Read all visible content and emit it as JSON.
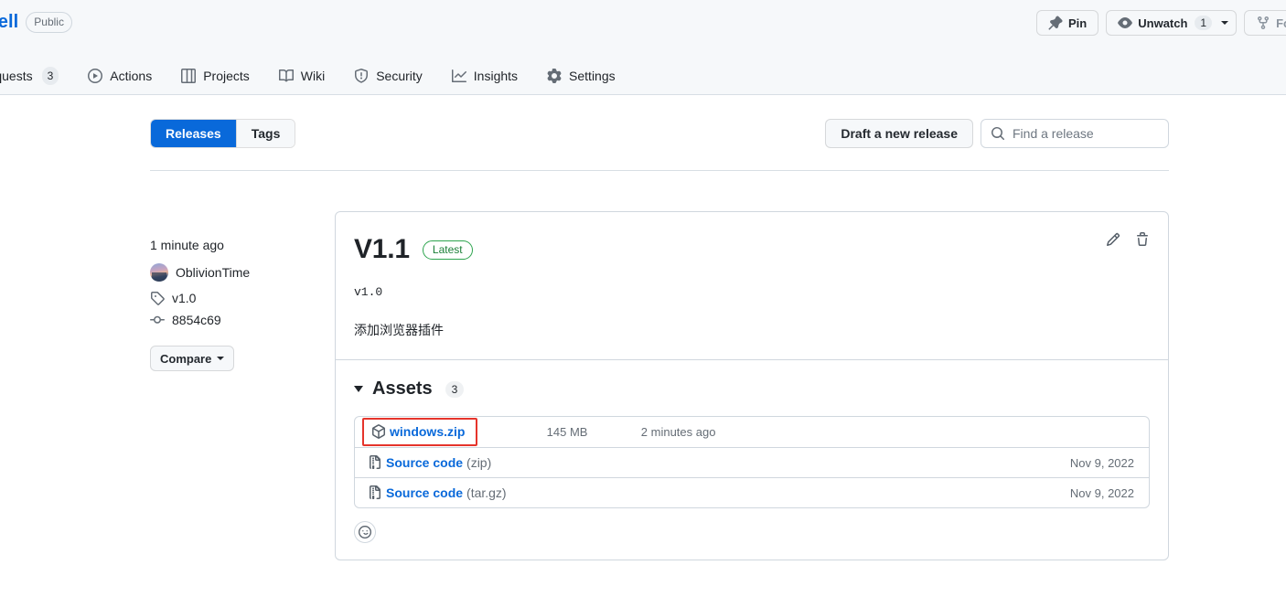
{
  "repo": {
    "name": "teShell",
    "visibility": "Public",
    "nav": [
      {
        "label": "ull requests",
        "icon": "pull-request-icon",
        "count": "3"
      },
      {
        "label": "Actions",
        "icon": "play-icon",
        "count": null
      },
      {
        "label": "Projects",
        "icon": "table-icon",
        "count": null
      },
      {
        "label": "Wiki",
        "icon": "book-icon",
        "count": null
      },
      {
        "label": "Security",
        "icon": "shield-icon",
        "count": null
      },
      {
        "label": "Insights",
        "icon": "graph-icon",
        "count": null
      },
      {
        "label": "Settings",
        "icon": "gear-icon",
        "count": null
      }
    ],
    "actions": {
      "pin_label": "Pin",
      "watch_label": "Unwatch",
      "watch_count": "1",
      "fork_label": "Fo"
    }
  },
  "toolbar": {
    "tabs": [
      {
        "label": "Releases",
        "active": true
      },
      {
        "label": "Tags",
        "active": false
      }
    ],
    "draft_label": "Draft a new release",
    "search_placeholder": "Find a release",
    "search_value": ""
  },
  "release": {
    "published": "1 minute ago",
    "author": "OblivionTime",
    "tag": "v1.0",
    "commit": "8854c69",
    "compare_label": "Compare",
    "title": "V1.1",
    "latest_badge": "Latest",
    "body_code": "v1.0",
    "body_text": "添加浏览器插件"
  },
  "assets": {
    "title": "Assets",
    "count": "3",
    "rows": [
      {
        "name": "windows.zip",
        "suffix": "",
        "icon": "package-icon",
        "size": "145 MB",
        "date": "2 minutes ago",
        "highlighted": true
      },
      {
        "name": "Source code",
        "suffix": " (zip)",
        "icon": "file-zip-icon",
        "size": "",
        "date": "Nov 9, 2022",
        "highlighted": false
      },
      {
        "name": "Source code",
        "suffix": " (tar.gz)",
        "icon": "file-zip-icon",
        "size": "",
        "date": "Nov 9, 2022",
        "highlighted": false
      }
    ]
  },
  "colors": {
    "accent_blue": "#0969da",
    "latest_green": "#2da44e",
    "annotation_red": "#e5342b",
    "header_bg": "#f6f8fa",
    "border": "#d0d7de"
  }
}
